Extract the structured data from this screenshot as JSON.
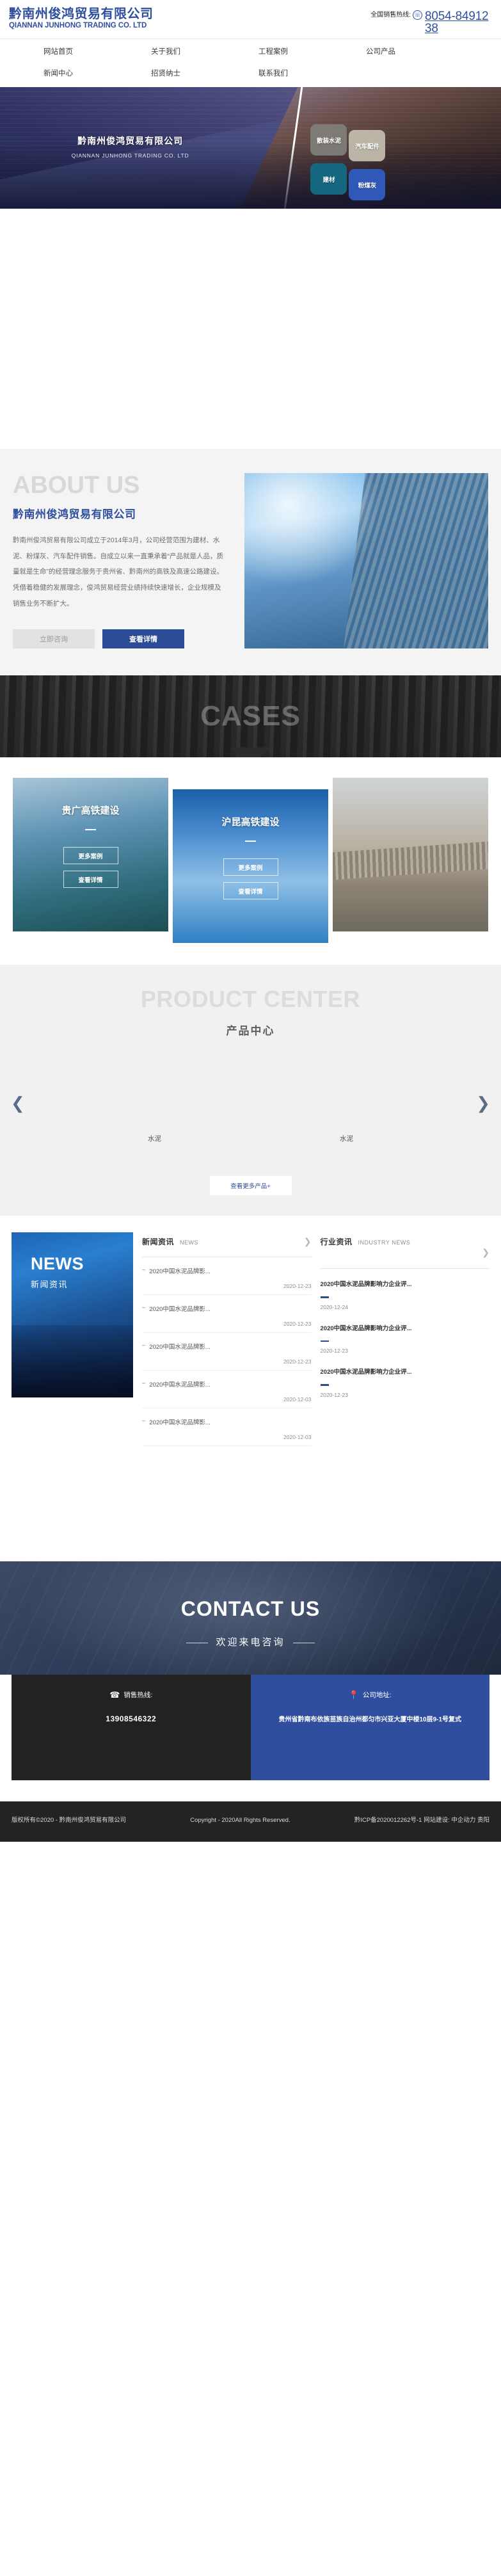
{
  "header": {
    "logo_cn": "黔南州俊鸿贸易有限公司",
    "logo_en": "QIANNAN JUNHONG TRADING CO. LTD",
    "hotline_label": "全国销售热线:",
    "hotline_icon": "phone-icon",
    "hotline_number": "8054-8491238"
  },
  "nav": {
    "items": [
      {
        "label": "网站首页"
      },
      {
        "label": "关于我们"
      },
      {
        "label": "工程案例"
      },
      {
        "label": "公司产品"
      },
      {
        "label": "新闻中心"
      },
      {
        "label": "招贤纳士"
      },
      {
        "label": "联系我们"
      }
    ]
  },
  "hero": {
    "title_cn": "黔南州俊鸿贸易有限公司",
    "title_en": "QIANNAN JUNHONG TRADING CO. LTD",
    "tiles": [
      {
        "label": "散装水泥"
      },
      {
        "label": "汽车配件"
      },
      {
        "label": "建材"
      },
      {
        "label": "粉煤灰"
      }
    ]
  },
  "about": {
    "bigword": "ABOUT US",
    "heading": "黔南州俊鸿贸易有限公司",
    "body": "黔南州俊鸿贸易有限公司成立于2014年3月，公司经营范围为建材、水泥、粉煤灰、汽车配件销售。自成立以来一直秉承着“产品就是人品，质量就是生命”的经营理念服务于贵州省、黔南州的高铁及高速公路建设。凭借着稳健的发展理念，俊鸿贸易经营业绩持续快速增长，企业规模及销售业务不断扩大。",
    "btn_consult": "立即咨询",
    "btn_detail": "查看详情"
  },
  "cases": {
    "bigword": "CASES",
    "cards": [
      {
        "title": "贵广高铁建设",
        "btn_more": "更多案例",
        "btn_detail": "查看详情"
      },
      {
        "title": "沪昆高铁建设",
        "btn_more": "更多案例",
        "btn_detail": "查看详情"
      },
      {
        "title": "",
        "btn_more": "",
        "btn_detail": ""
      }
    ]
  },
  "products": {
    "bigword": "PRODUCT CENTER",
    "subtitle": "产品中心",
    "prev_icon": "chevron-left-icon",
    "next_icon": "chevron-right-icon",
    "items": [
      {
        "name": "水泥"
      },
      {
        "name": "水泥"
      }
    ],
    "more_label": "查看更多产品+"
  },
  "news": {
    "banner_en": "NEWS",
    "banner_cn": "新闻资讯",
    "company": {
      "title_cn": "新闻资讯",
      "title_en": "NEWS",
      "more_icon": "chevron-right-icon",
      "items": [
        {
          "title": "2020中国水泥品牌影...",
          "date": "2020-12-23"
        },
        {
          "title": "2020中国水泥品牌影...",
          "date": "2020-12-23"
        },
        {
          "title": "2020中国水泥品牌影...",
          "date": "2020-12-23"
        },
        {
          "title": "2020中国水泥品牌影...",
          "date": "2020-12-03"
        },
        {
          "title": "2020中国水泥品牌影...",
          "date": "2020-12-03"
        }
      ]
    },
    "industry": {
      "title_cn": "行业资讯",
      "title_en": "INDUSTRY NEWS",
      "more_icon": "chevron-right-icon",
      "items": [
        {
          "title": "2020中国水泥品牌影响力企业评...",
          "date": "2020-12-24"
        },
        {
          "title": "2020中国水泥品牌影响力企业评...",
          "date": "2020-12-23"
        },
        {
          "title": "2020中国水泥品牌影响力企业评...",
          "date": "2020-12-23"
        }
      ]
    }
  },
  "contact": {
    "title_en": "CONTACT US",
    "title_cn": "欢迎来电咨询",
    "phone_card": {
      "icon": "phone-icon",
      "label": "销售热线:",
      "value": "13908546322"
    },
    "address_card": {
      "icon": "location-pin-icon",
      "label": "公司地址:",
      "value": "贵州省黔南布依族苗族自治州都匀市兴亚大厦中楼10层9-1号复式"
    }
  },
  "footer": {
    "copyright_cn": "版权所有©2020 - 黔南州俊鸿贸易有限公司",
    "copyright_en": "Copyright - 2020All Rights Reserved.",
    "icp": "黔ICP备2020012262号-1",
    "builder": "网站建设: 中企动力 贵阳"
  }
}
